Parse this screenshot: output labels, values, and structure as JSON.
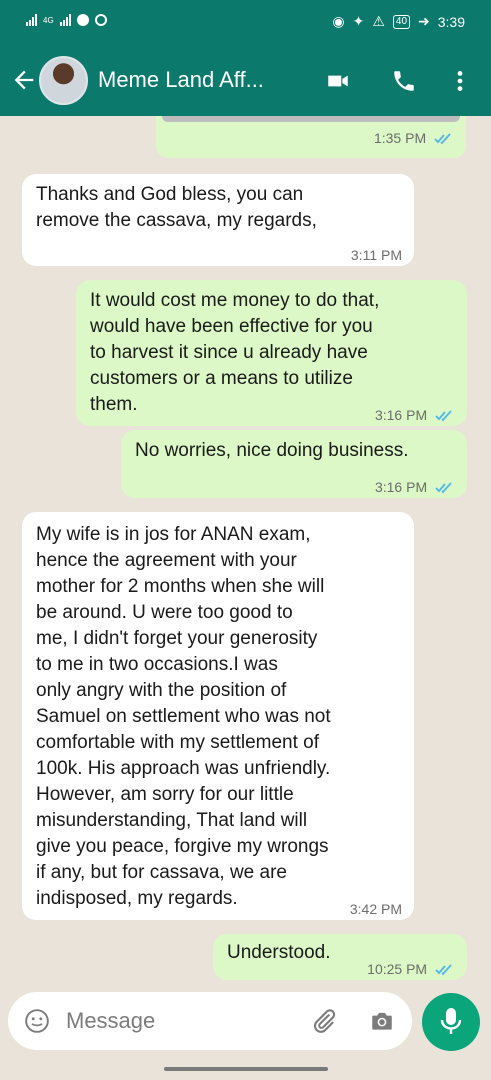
{
  "status_bar": {
    "network_label": "4G",
    "battery": "40",
    "time": "3:39"
  },
  "header": {
    "title": "Meme Land Aff...",
    "icons": [
      "back-arrow-icon",
      "video-call-icon",
      "phone-icon",
      "more-vert-icon"
    ]
  },
  "messages": [
    {
      "direction": "outgoing",
      "text": "",
      "time": "1:35 PM",
      "read": true
    },
    {
      "direction": "incoming",
      "text": "Thanks and God bless, you can\nremove the cassava, my regards,",
      "time": "3:11 PM"
    },
    {
      "direction": "outgoing",
      "text": "It would cost me money to do that,\nwould have been effective for you\nto harvest it since u already have\ncustomers or a means to utilize\nthem.",
      "time": "3:16 PM",
      "read": true
    },
    {
      "direction": "outgoing",
      "text": "No worries, nice doing business.",
      "time": "3:16 PM",
      "read": true
    },
    {
      "direction": "incoming",
      "text": "My wife is in jos for ANAN exam,\nhence the agreement with your\nmother for 2 months when she will\nbe around. U were too good to\nme, I didn't forget your generosity\nto me in two occasions.I was\nonly angry with the position of\nSamuel on settlement who was not\ncomfortable with my settlement of\n100k. His approach was unfriendly.\nHowever, am sorry for our little\nmisunderstanding, That land will\ngive you peace, forgive my wrongs\nif any, but for cassava, we are\nindisposed, my regards.",
      "time": "3:42 PM"
    },
    {
      "direction": "outgoing",
      "text": "Understood.",
      "time": "10:25 PM",
      "read": true
    }
  ],
  "composer": {
    "placeholder": "Message",
    "icons": [
      "emoji-icon",
      "attach-icon",
      "camera-icon",
      "mic-icon"
    ]
  },
  "colors": {
    "header": "#0b7a6c",
    "outgoing_bubble": "#dcf8c6",
    "incoming_bubble": "#ffffff",
    "background": "#e9e3da",
    "read_ticks": "#4fb6ec",
    "mic_button": "#0aa57a"
  }
}
